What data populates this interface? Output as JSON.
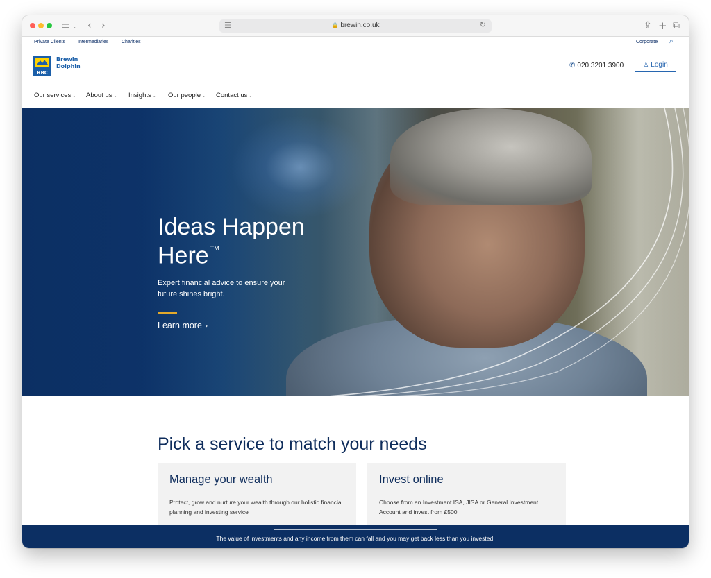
{
  "browser": {
    "url": "brewin.co.uk",
    "toolbar_icons": [
      "sidebar-icon",
      "back-icon",
      "forward-icon",
      "share-icon",
      "new-tab-icon",
      "tabs-overview-icon"
    ]
  },
  "utility_nav": {
    "links": [
      "Private Clients",
      "Intermediaries",
      "Charities"
    ],
    "corporate": "Corporate",
    "search_icon": "search-icon"
  },
  "header": {
    "logo_line1": "Brewin",
    "logo_line2": "Dolphin",
    "logo_mark": "RBC",
    "phone": "020 3201 3900",
    "login": "Login"
  },
  "nav": {
    "items": [
      "Our services",
      "About us",
      "Insights",
      "Our people",
      "Contact us"
    ]
  },
  "hero": {
    "title_line1": "Ideas Happen",
    "title_line2": "Here",
    "trademark": "TM",
    "subtitle": "Expert financial advice to ensure your future shines bright.",
    "cta": "Learn more",
    "accent_color": "#e3a92b"
  },
  "services": {
    "title": "Pick a service to match your needs",
    "cards": [
      {
        "title": "Manage your wealth",
        "description": "Protect, grow and nurture your wealth through our holistic financial planning and investing service"
      },
      {
        "title": "Invest online",
        "description": "Choose from an Investment ISA, JISA or General Investment Account and invest from £500"
      }
    ]
  },
  "risk_warning": {
    "text": "The value of investments and any income from them can fall and you may get back less than you invested."
  },
  "colors": {
    "brand_navy": "#0c2f63",
    "link_blue": "#2766b0"
  }
}
